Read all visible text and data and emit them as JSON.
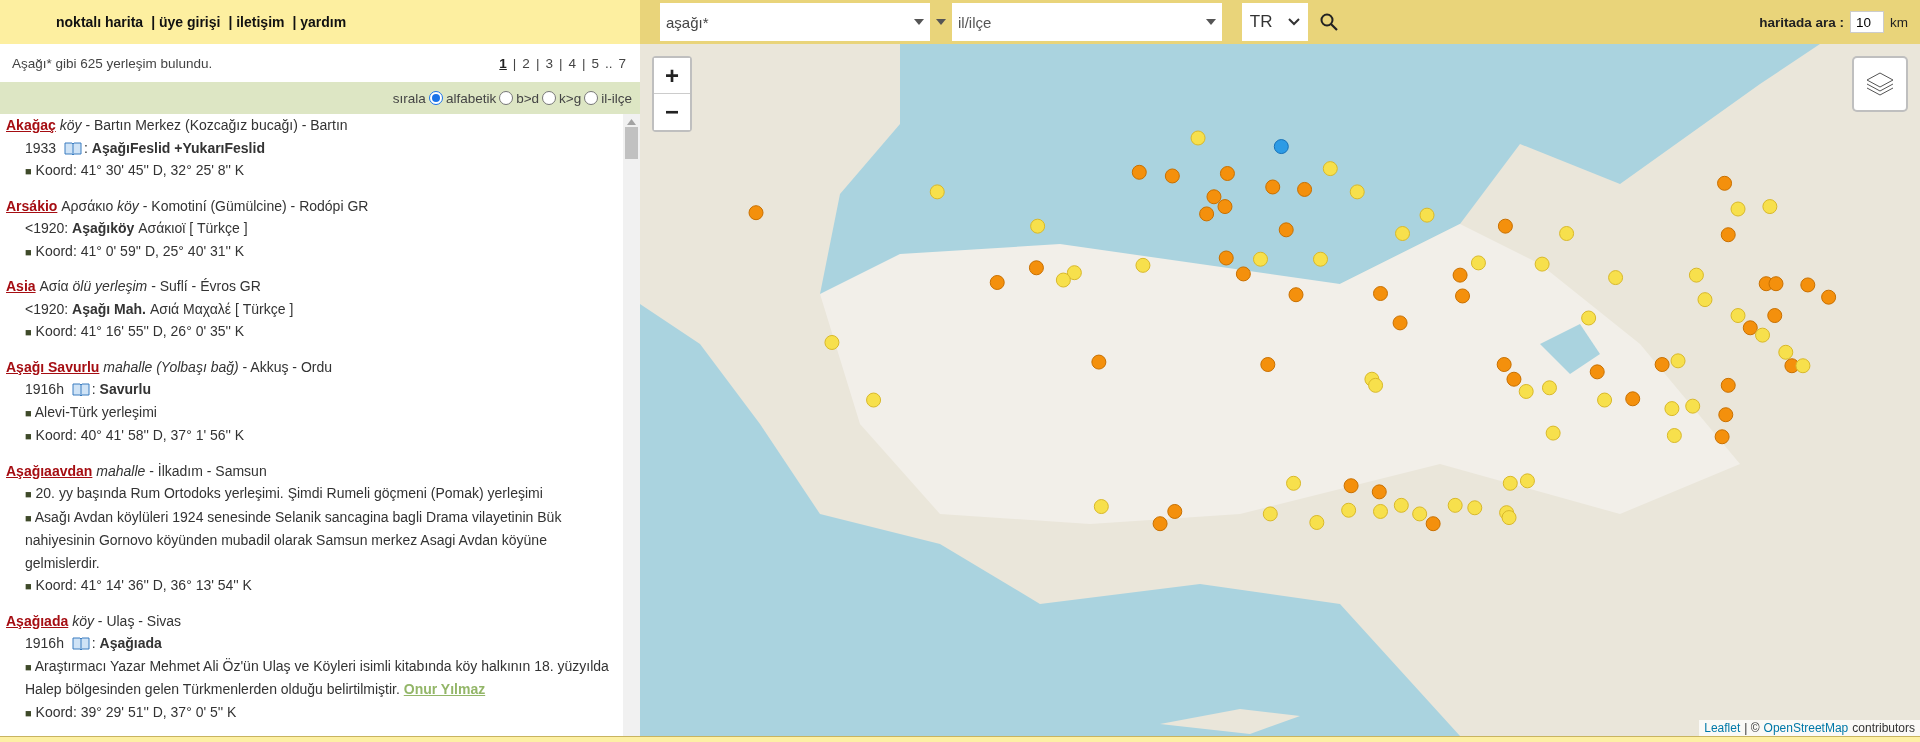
{
  "nav": {
    "links": [
      "noktalı harita",
      "| üye girişi",
      "| iletişim",
      "| yardım"
    ]
  },
  "search": {
    "query": "aşağı*",
    "district_placeholder": "il/ilçe",
    "country": "TR",
    "radius_label": "haritada ara :",
    "radius_value": "10",
    "radius_unit": "km"
  },
  "results": {
    "summary": "Aşağı* gibi 625 yerleşim bulundu.",
    "pages": [
      {
        "label": "1",
        "selected": true
      },
      {
        "label": "2",
        "selected": false
      },
      {
        "label": "3",
        "selected": false
      },
      {
        "label": "4",
        "selected": false
      },
      {
        "label": "5",
        "selected": false
      }
    ],
    "pages_separator": "|",
    "bullet": "■",
    "pages_gap": "..",
    "last_page": "7",
    "sort_label": "sırala",
    "sort_options": [
      {
        "label": "alfabetik",
        "selected": true
      },
      {
        "label": "b>d",
        "selected": false
      },
      {
        "label": "k>g",
        "selected": false
      },
      {
        "label": "il-ilçe",
        "selected": false
      }
    ]
  },
  "entries": [
    {
      "name": "Akağaç",
      "type": "köy",
      "place": "- Bartın Merkez (Kozcağız bucağı) - Bartın",
      "lines": [
        {
          "kind": "source",
          "prefix": "1933",
          "separator": ":",
          "text": "AşağıFeslid +YukarıFeslid"
        },
        {
          "kind": "note",
          "text": "Koord: 41° 30' 45'' D, 32° 25' 8'' K"
        }
      ]
    },
    {
      "name": "Arsákio",
      "alt_name": "Αρσάκιο",
      "type": "köy",
      "place": "- Komotiní (Gümülcine) - Rodópi GR",
      "lines": [
        {
          "kind": "plain",
          "text": "<1920: **Aşağıköy** Ασάκιοϊ [ Türkçe ]"
        },
        {
          "kind": "note",
          "text": "Koord: 41° 0' 59'' D, 25° 40' 31'' K"
        }
      ]
    },
    {
      "name": "Asia",
      "alt_name": "Ασία",
      "type": "ölü yerleşim",
      "place": "- Suflí - Évros GR",
      "lines": [
        {
          "kind": "plain",
          "text": "<1920: **Aşağı Mah.** Ασιά Μαχαλέ [ Türkçe ]"
        },
        {
          "kind": "note",
          "text": "Koord: 41° 16' 55'' D, 26° 0' 35'' K"
        }
      ]
    },
    {
      "name": "Aşağı Savurlu",
      "type": "mahalle (Yolbaşı bağ)",
      "place": "- Akkuş - Ordu",
      "lines": [
        {
          "kind": "source",
          "prefix": "1916h",
          "separator": ":",
          "text": "Savurlu"
        },
        {
          "kind": "note",
          "text": "Alevi-Türk yerleşimi"
        },
        {
          "kind": "note",
          "text": "Koord: 40° 41' 58'' D, 37° 1' 56'' K"
        }
      ]
    },
    {
      "name": "Aşağıaavdan",
      "type": "mahalle",
      "place": "- İlkadım - Samsun",
      "lines": [
        {
          "kind": "note",
          "text": "20. yy başında Rum Ortodoks yerleşimi. Şimdi Rumeli göçmeni (Pomak) yerleşimi"
        },
        {
          "kind": "note",
          "text": "Asağı Avdan köylüleri 1924 senesinde Selanik sancagina bagli Drama vilayetinin Bük nahiyesinin Gornovo köyünden mubadil olarak Samsun merkez Asagi Avdan köyüne gelmislerdir."
        },
        {
          "kind": "note",
          "text": "Koord: 41° 14' 36'' D, 36° 13' 54'' K"
        }
      ]
    },
    {
      "name": "Aşağıada",
      "type": "köy",
      "place": "- Ulaş - Sivas",
      "lines": [
        {
          "kind": "source",
          "prefix": "1916h",
          "separator": ":",
          "text": "Aşağıada"
        },
        {
          "kind": "note",
          "text": "Araştırmacı Yazar Mehmet Ali Öz'ün Ulaş ve Köyleri isimli kitabında köy halkının 18. yüzyılda Halep bölgesinden gelen Türkmenlerden olduğu belirtilmiştir.",
          "link": "Onur Yılmaz"
        },
        {
          "kind": "note",
          "text": "Koord: 39° 29' 51'' D, 37° 0' 5'' K"
        }
      ]
    }
  ],
  "map": {
    "zoom_in": "+",
    "zoom_out": "−",
    "attribution_link1": "Leaflet",
    "attribution_sep": "| ©",
    "attribution_link2": "OpenStreetMap",
    "attribution_rest": "contributors"
  }
}
